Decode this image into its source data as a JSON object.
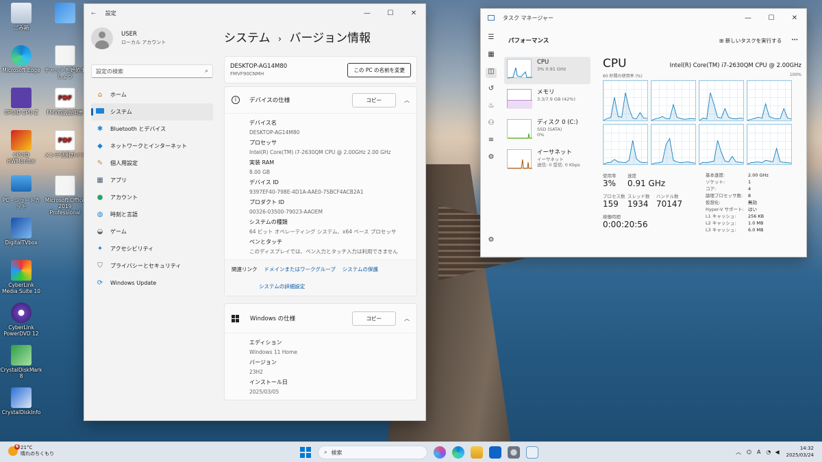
{
  "desktop": {
    "icons": [
      {
        "label": "ごみ箱"
      },
      {
        "label": ""
      },
      {
        "label": "Microsoft Edge"
      },
      {
        "label": "チャットを始めましょう"
      },
      {
        "label": "CPUID CPU-Z"
      },
      {
        "label": "FMV取扱説明書"
      },
      {
        "label": "CPUID HWMonitor"
      },
      {
        "label": "メンテ活用ガイド"
      },
      {
        "label": "PC - ショートカット"
      },
      {
        "label": "Microsoft Office 2019 Professional"
      },
      {
        "label": "DigitalTVbox"
      },
      {
        "label": "CyberLink Media Suite 10"
      },
      {
        "label": "CyberLink PowerDVD 12"
      },
      {
        "label": "CrystalDiskMark 8"
      },
      {
        "label": "CrystalDiskInfo"
      }
    ]
  },
  "settings": {
    "window_title": "設定",
    "user": {
      "name": "USER",
      "type": "ローカル アカウント"
    },
    "search_placeholder": "設定の検索",
    "nav": [
      {
        "label": "ホーム",
        "icon": "home-icon"
      },
      {
        "label": "システム",
        "icon": "system-icon"
      },
      {
        "label": "Bluetooth とデバイス",
        "icon": "bluetooth-icon"
      },
      {
        "label": "ネットワークとインターネット",
        "icon": "wifi-icon"
      },
      {
        "label": "個人用設定",
        "icon": "brush-icon"
      },
      {
        "label": "アプリ",
        "icon": "apps-icon"
      },
      {
        "label": "アカウント",
        "icon": "account-icon"
      },
      {
        "label": "時刻と言語",
        "icon": "globe-icon"
      },
      {
        "label": "ゲーム",
        "icon": "gamepad-icon"
      },
      {
        "label": "アクセシビリティ",
        "icon": "accessibility-icon"
      },
      {
        "label": "プライバシーとセキュリティ",
        "icon": "shield-icon"
      },
      {
        "label": "Windows Update",
        "icon": "update-icon"
      }
    ],
    "breadcrumb": {
      "parent": "システム",
      "separator": "›",
      "current": "バージョン情報"
    },
    "pc": {
      "name": "DESKTOP-AG14M80",
      "model": "FMVF90CNMH",
      "rename_button": "この PC の名前を変更"
    },
    "device_specs": {
      "title": "デバイスの仕様",
      "copy": "コピー",
      "items": [
        {
          "key": "デバイス名",
          "value": "DESKTOP-AG14M80"
        },
        {
          "key": "プロセッサ",
          "value": "Intel(R) Core(TM) i7-2630QM CPU @ 2.00GHz   2.00 GHz"
        },
        {
          "key": "実装 RAM",
          "value": "8.00 GB"
        },
        {
          "key": "デバイス ID",
          "value": "9397EF40-798E-4D1A-AAE0-7SBCF4ACB2A1"
        },
        {
          "key": "プロダクト ID",
          "value": "00326-03500-79023-AAOEM"
        },
        {
          "key": "システムの種類",
          "value": "64 ビット オペレーティング システム、x64 ベース プロセッサ"
        },
        {
          "key": "ペンとタッチ",
          "value": "このディスプレイでは、ペン入力とタッチ入力は利用できません"
        }
      ]
    },
    "related": {
      "label": "関連リンク",
      "links": [
        "ドメインまたはワークグループ",
        "システムの保護",
        "システムの詳細設定"
      ]
    },
    "windows_specs": {
      "title": "Windows の仕様",
      "copy": "コピー",
      "items": [
        {
          "key": "エディション",
          "value": "Windows 11 Home"
        },
        {
          "key": "バージョン",
          "value": "23H2"
        },
        {
          "key": "インストール日",
          "value": "2025/03/05"
        }
      ]
    }
  },
  "taskmanager": {
    "window_title": "タスク マネージャー",
    "section": "パフォーマンス",
    "new_task": "新しいタスクを実行する",
    "more": "···",
    "perf_items": [
      {
        "title": "CPU",
        "sub1": "3%  0.91 GHz",
        "sub2": ""
      },
      {
        "title": "メモリ",
        "sub1": "3.3/7.9 GB (42%)",
        "sub2": ""
      },
      {
        "title": "ディスク 0 (C:)",
        "sub1": "SSD (SATA)",
        "sub2": "0%"
      },
      {
        "title": "イーサネット",
        "sub1": "イーサネット",
        "sub2": "送信: 0 受信: 0 Kbps"
      }
    ],
    "cpu": {
      "title": "CPU",
      "model": "Intel(R) Core(TM) i7-2630QM CPU @ 2.00GHz",
      "axis_left": "60 秒間の使用率 (%)",
      "axis_right": "100%",
      "stats": {
        "usage_label": "使用率",
        "usage": "3%",
        "speed_label": "速度",
        "speed": "0.91 GHz",
        "proc_label": "プロセス数",
        "proc": "159",
        "thread_label": "スレッド数",
        "thread": "1934",
        "handle_label": "ハンドル数",
        "handle": "70147",
        "uptime_label": "稼働時間",
        "uptime": "0:00:20:56"
      },
      "details": [
        {
          "k": "基本速度:",
          "v": "2.00 GHz"
        },
        {
          "k": "ソケット:",
          "v": "1"
        },
        {
          "k": "コア:",
          "v": "4"
        },
        {
          "k": "論理プロセッサ数:",
          "v": "8"
        },
        {
          "k": "仮想化:",
          "v": "無効"
        },
        {
          "k": "Hyper-V サポート:",
          "v": "はい"
        },
        {
          "k": "L1 キャッシュ:",
          "v": "256 KB"
        },
        {
          "k": "L2 キャッシュ:",
          "v": "1.0 MB"
        },
        {
          "k": "L3 キャッシュ:",
          "v": "6.0 MB"
        }
      ]
    }
  },
  "taskbar": {
    "weather_temp": "21°C",
    "weather_desc": "晴れのちくもり",
    "weather_badge": "6",
    "search": "検索",
    "time": "14:32",
    "date": "2025/03/24",
    "ime": "A"
  }
}
